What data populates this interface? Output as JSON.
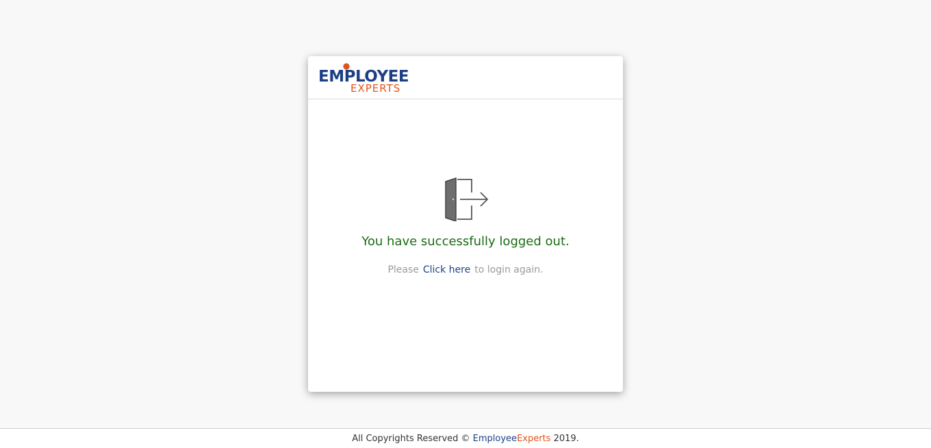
{
  "header": {
    "logo": {
      "top_text": "EMPLOYEE",
      "bottom_text": "EXPERTS",
      "icon": "person-logo-icon",
      "primary_color": "#1d3f86",
      "accent_color": "#e3531b"
    }
  },
  "main": {
    "icon": "logout-door-icon",
    "message": "You have successfully logged out.",
    "relogin": {
      "prefix": "Please",
      "link_label": "Click here",
      "suffix": "to login again."
    },
    "message_color": "#1a6b12",
    "link_color": "#1d3f86"
  },
  "footer": {
    "prefix": "All Copyrights Reserved ©",
    "brand_part1": "Employee",
    "brand_part2": "Experts",
    "suffix": "2019."
  }
}
